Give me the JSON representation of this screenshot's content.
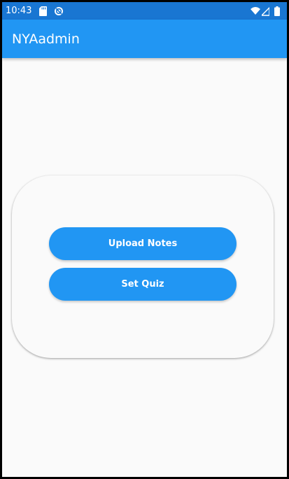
{
  "status_bar": {
    "time": "10:43",
    "left_icons": [
      "sd-card-icon",
      "sync-icon"
    ],
    "right_icons": [
      "wifi-icon",
      "signal-icon",
      "battery-icon"
    ],
    "color": "#1976d2"
  },
  "app_bar": {
    "title": "NYAadmin",
    "color": "#2196f3"
  },
  "card": {
    "buttons": [
      {
        "label": "Upload Notes"
      },
      {
        "label": "Set Quiz"
      }
    ],
    "button_color": "#2196f3"
  }
}
